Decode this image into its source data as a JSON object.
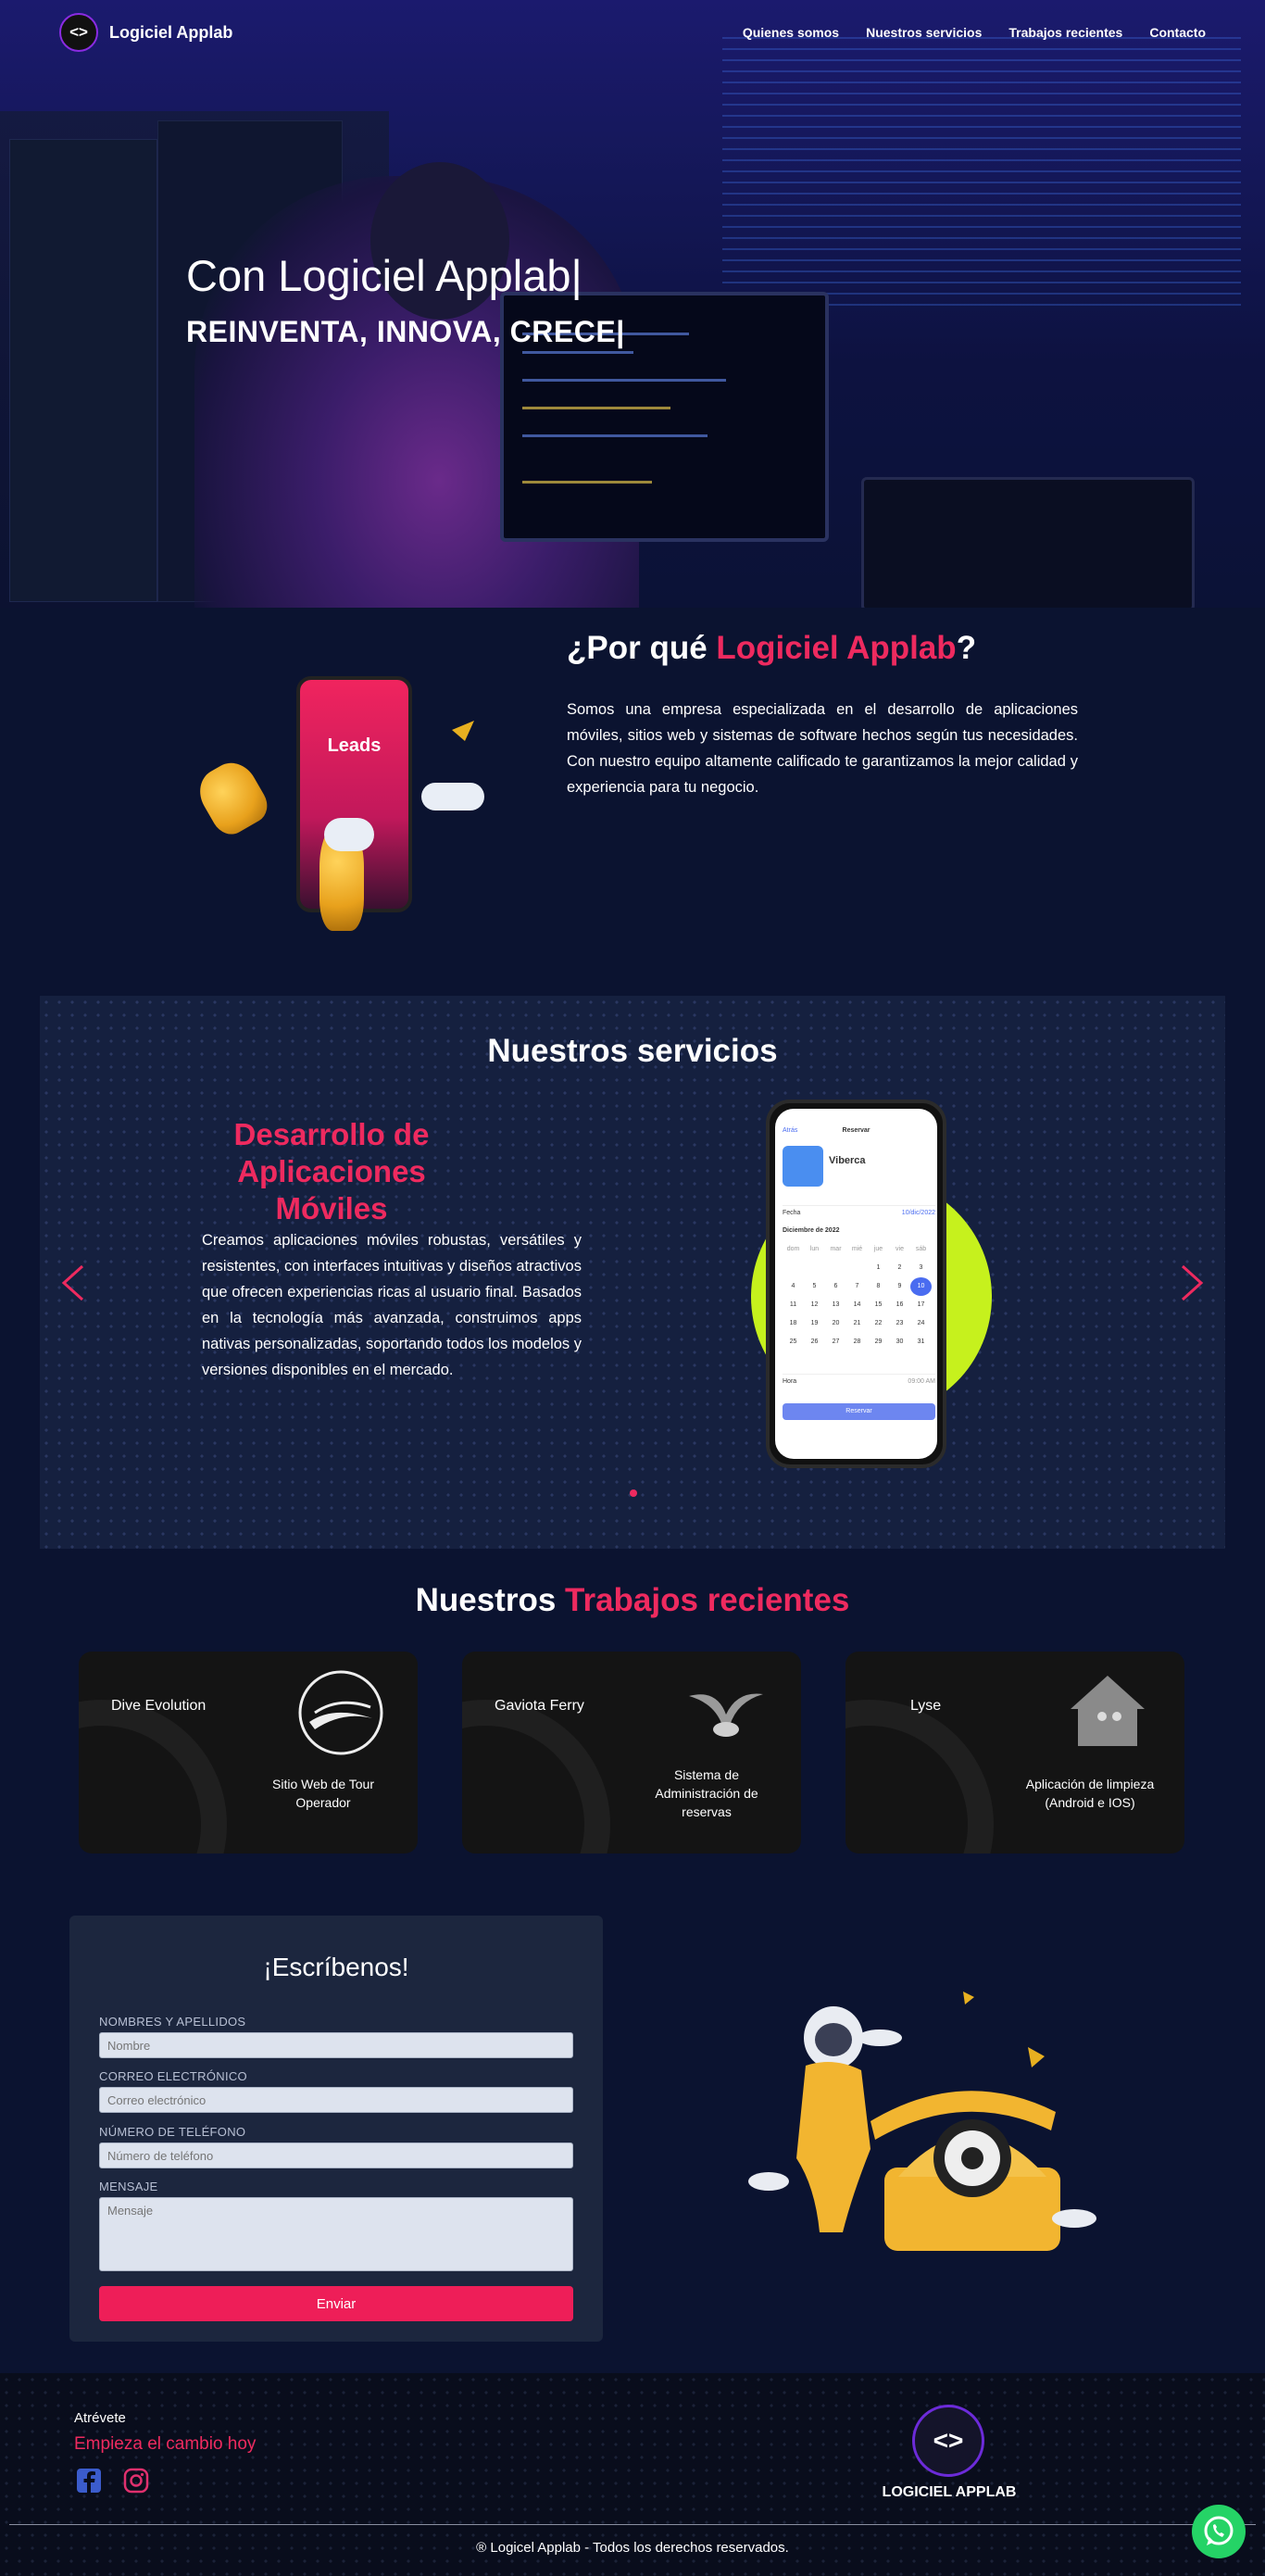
{
  "nav": {
    "brand": "Logiciel Applab",
    "logo_glyph": "<>",
    "links": [
      "Quienes somos",
      "Nuestros servicios",
      "Trabajos recientes",
      "Contacto"
    ]
  },
  "hero": {
    "title": "Con Logiciel Applab|",
    "subtitle": "REINVENTA, INNOVA, CRECE|"
  },
  "why": {
    "title_prefix": "¿Por qué ",
    "title_highlight": "Logiciel Applab",
    "title_suffix": "?",
    "phone_label": "Leads",
    "text": "Somos una empresa especializada en el desarrollo de aplicaciones móviles, sitios web y sistemas de software hechos según tus necesidades. Con nuestro equipo altamente calificado te garantizamos la mejor calidad y experiencia para tu negocio."
  },
  "services": {
    "title": "Nuestros servicios",
    "slide_title": "Desarrollo de Aplicaciones Móviles",
    "slide_text": "Creamos aplicaciones móviles robustas, versátiles y resistentes, con interfaces intuitivas y diseños atractivos que ofrecen experiencias ricas al usuario final. Basados en la tecnología más avanzada, construimos apps nativas personalizadas, soportando todos los modelos y versiones disponibles en el mercado.",
    "phone": {
      "header": "Reservar",
      "back": "Atrás",
      "app_name": "Viberca",
      "field_date": "Fecha",
      "field_date_value": "10/dic/2022",
      "month": "Diciembre de 2022",
      "days": [
        "dom",
        "lun",
        "mar",
        "mié",
        "jue",
        "vie",
        "sáb"
      ],
      "weeks": [
        [
          "",
          "",
          "",
          "",
          "1",
          "2",
          "3"
        ],
        [
          "4",
          "5",
          "6",
          "7",
          "8",
          "9",
          "10"
        ],
        [
          "11",
          "12",
          "13",
          "14",
          "15",
          "16",
          "17"
        ],
        [
          "18",
          "19",
          "20",
          "21",
          "22",
          "23",
          "24"
        ],
        [
          "25",
          "26",
          "27",
          "28",
          "29",
          "30",
          "31"
        ]
      ],
      "field_time": "Hora",
      "field_time_value": "09:00 AM",
      "button": "Reservar"
    }
  },
  "works": {
    "title_prefix": "Nuestros ",
    "title_highlight": "Trabajos recientes",
    "cards": [
      {
        "name": "Dive Evolution",
        "desc": "Sitio Web de Tour Operador",
        "icon": "wave-logo-icon"
      },
      {
        "name": "Gaviota Ferry",
        "desc": "Sistema de Administración de reservas",
        "icon": "seagull-icon"
      },
      {
        "name": "Lyse",
        "desc": "Aplicación de limpieza (Android e IOS)",
        "icon": "house-logo-icon"
      }
    ]
  },
  "contact": {
    "title": "¡Escríbenos!",
    "name_label": "NOMBRES Y APELLIDOS",
    "name_placeholder": "Nombre",
    "email_label": "CORREO ELECTRÓNICO",
    "email_placeholder": "Correo electrónico",
    "phone_label": "NÚMERO DE TELÉFONO",
    "phone_placeholder": "Número de teléfono",
    "message_label": "MENSAJE",
    "message_placeholder": "Mensaje",
    "submit": "Enviar"
  },
  "footer": {
    "dare": "Atrévete",
    "cta": "Empieza el cambio hoy",
    "logo_glyph": "<>",
    "logo_text": "LOGICIEL APPLAB",
    "copyright": "® Logicel Applab - Todos los derechos reservados."
  },
  "colors": {
    "accent": "#ee2a5f",
    "background": "#0b1330",
    "services_bg": "#15203f",
    "lime": "#c6f11d",
    "whatsapp": "#25d366"
  }
}
